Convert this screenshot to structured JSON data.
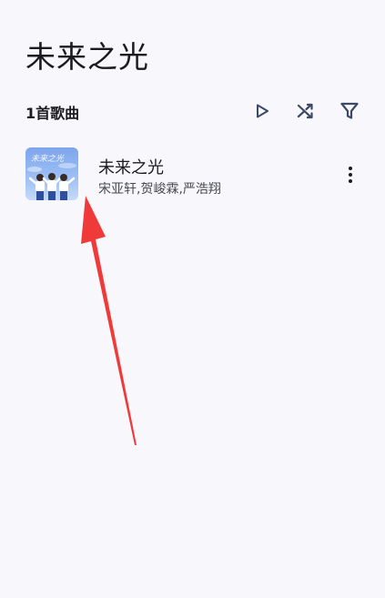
{
  "header": {
    "title": "未来之光"
  },
  "toolbar": {
    "song_count": "1首歌曲",
    "play_icon": "play-icon",
    "shuffle_icon": "shuffle-icon",
    "filter_icon": "filter-icon"
  },
  "songs": [
    {
      "title": "未来之光",
      "artist": "宋亚轩,贺峻霖,严浩翔",
      "cover_text": "未来之光",
      "more_icon": "more-vertical-icon"
    }
  ],
  "colors": {
    "background": "#f7f7fc",
    "icon": "#3c4a66",
    "annotation_arrow": "#f03a3a"
  }
}
